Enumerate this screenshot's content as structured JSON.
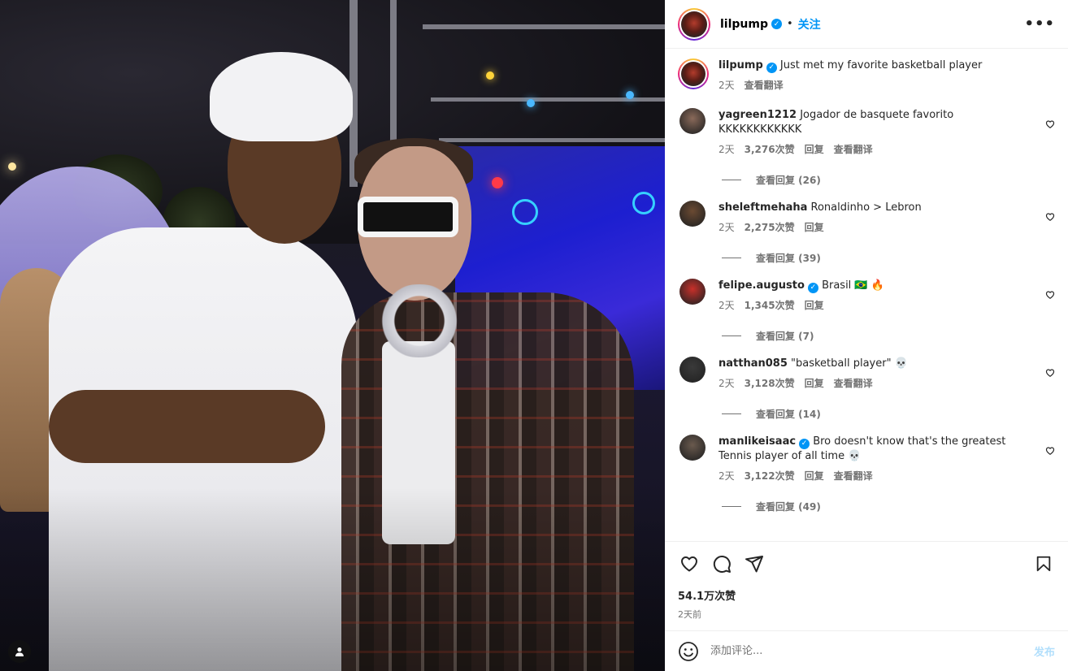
{
  "post": {
    "username": "lilpump",
    "separator": "•",
    "follow_label": "关注",
    "more_label": "•••",
    "caption": {
      "username": "lilpump",
      "text": "Just met my favorite basketball player",
      "time": "2天",
      "translate": "查看翻译"
    },
    "comments": [
      {
        "username": "yagreen1212",
        "text": "Jogador de basquete favorito KKKKKKKKKKKK",
        "verified": false,
        "time": "2天",
        "likes": "3,276次赞",
        "reply": "回复",
        "translate": "查看翻译",
        "replies": "查看回复 (26)",
        "avatar_color": "#8a6a5a"
      },
      {
        "username": "sheleftmehaha",
        "text": "Ronaldinho > Lebron",
        "verified": false,
        "time": "2天",
        "likes": "2,275次赞",
        "reply": "回复",
        "translate": "",
        "replies": "查看回复 (39)",
        "avatar_color": "#6b4a32"
      },
      {
        "username": "felipe.augusto",
        "text": "Brasil 🇧🇷 🔥",
        "verified": true,
        "time": "2天",
        "likes": "1,345次赞",
        "reply": "回复",
        "translate": "",
        "replies": "查看回复 (7)",
        "avatar_color": "#c8302a"
      },
      {
        "username": "natthan085",
        "text": "\"basketball player\" 💀",
        "verified": false,
        "time": "2天",
        "likes": "3,128次赞",
        "reply": "回复",
        "translate": "查看翻译",
        "replies": "查看回复 (14)",
        "avatar_color": "#3a3a3a"
      },
      {
        "username": "manlikeisaac",
        "text": "Bro doesn't know that's the greatest Tennis player of all time 💀",
        "verified": true,
        "time": "2天",
        "likes": "3,122次赞",
        "reply": "回复",
        "translate": "查看翻译",
        "replies": "查看回复 (49)",
        "avatar_color": "#6a5a4e"
      }
    ],
    "likes_count": "54.1万次赞",
    "posted": "2天前",
    "add_comment_placeholder": "添加评论...",
    "post_button": "发布"
  },
  "icons": {
    "like": "heart-icon",
    "comment": "comment-icon",
    "share": "share-icon",
    "save": "bookmark-icon",
    "emoji": "emoji-icon",
    "tag": "user-tag-icon"
  },
  "colors": {
    "accent": "#0095f6",
    "post_disabled": "#b2dffc",
    "muted": "#737373"
  }
}
